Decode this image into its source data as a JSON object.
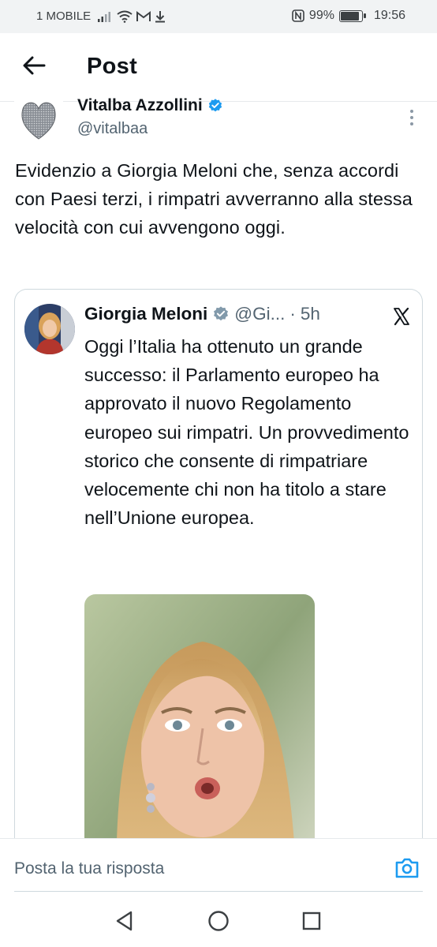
{
  "status_bar": {
    "carrier": "1 MOBILE",
    "battery": "99%",
    "battery_level": 0.99,
    "time": "19:56",
    "icons": [
      "signal-icon",
      "wifi-icon",
      "gmail-icon",
      "download-icon",
      "nfc-icon",
      "battery-icon"
    ]
  },
  "header": {
    "title": "Post",
    "back_icon": "arrow-left-icon"
  },
  "post": {
    "author_name": "Vitalba Azzollini",
    "author_handle": "@vitalbaa",
    "verified": true,
    "text": "Evidenzio a Giorgia Meloni che, senza accordi con Paesi terzi, i rimpatri avverranno alla stessa velocità con cui avvengono oggi.",
    "more_icon": "more-vertical-icon"
  },
  "quoted_post": {
    "author_name": "Giorgia Meloni",
    "author_handle": "@Gi...",
    "separator": "·",
    "time": "5h",
    "verified_color": "#829aab",
    "text": "Oggi l’Italia ha ottenuto un grande successo: il Parlamento europeo ha approvato il nuovo Regolamento europeo sui rimpatri. Un provvedimento storico che consente di rimpatriare velocemente chi non ha titolo a stare nell’Unione europea.",
    "source_icon": "x-logo-icon",
    "media": "photo"
  },
  "reply": {
    "placeholder": "Posta la tua risposta",
    "camera_icon": "camera-icon"
  },
  "nav": {
    "buttons": [
      "back-triangle-icon",
      "home-circle-icon",
      "recents-square-icon"
    ]
  },
  "colors": {
    "accent": "#1d9bf0",
    "text": "#0f1419",
    "secondary_text": "#536471",
    "border": "#cfd9de"
  }
}
